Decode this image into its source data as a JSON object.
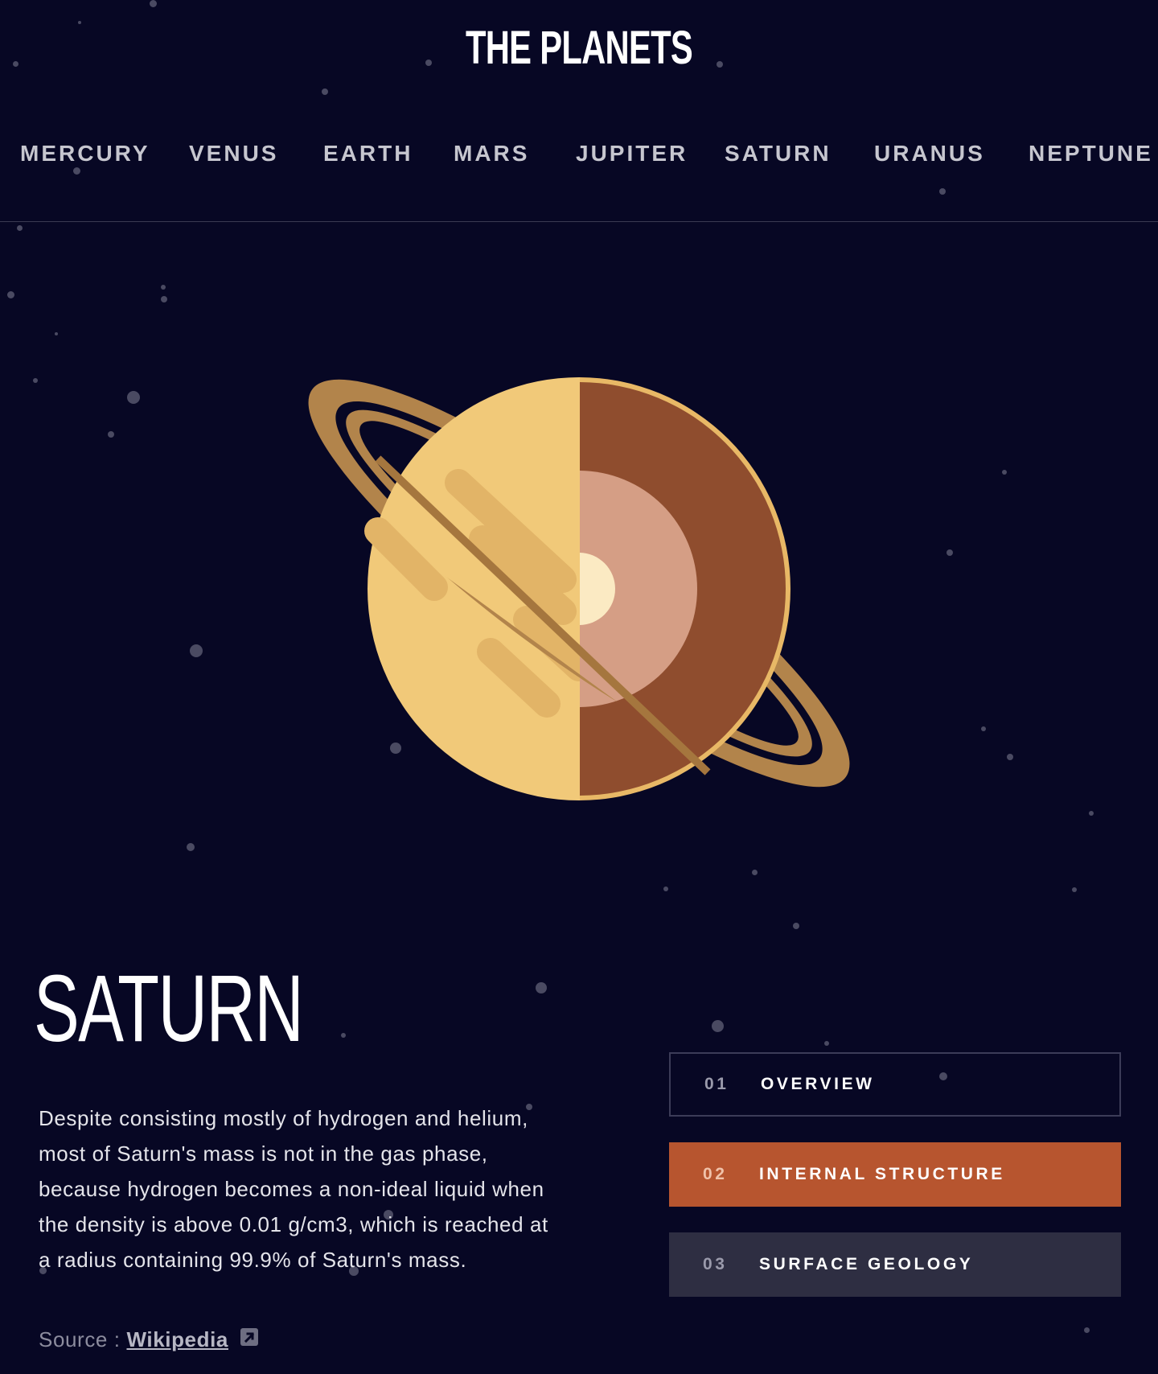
{
  "header": {
    "logo": "THE PLANETS"
  },
  "nav": {
    "items": [
      "MERCURY",
      "VENUS",
      "EARTH",
      "MARS",
      "JUPITER",
      "SATURN",
      "URANUS",
      "NEPTUNE"
    ]
  },
  "planet": {
    "name": "SATURN",
    "description": "Despite consisting mostly of hydrogen and helium, most of Saturn's mass is not in the gas phase, because hydrogen becomes a non-ideal liquid when the density is above 0.01 g/cm3, which is reached at a radius containing 99.9% of Saturn's mass.",
    "source_prefix": "Source : ",
    "source_link": "Wikipedia"
  },
  "tabs": [
    {
      "number": "01",
      "label": "OVERVIEW",
      "state": "inactive"
    },
    {
      "number": "02",
      "label": "INTERNAL STRUCTURE",
      "state": "active"
    },
    {
      "number": "03",
      "label": "SURFACE GEOLOGY",
      "state": "inactive"
    }
  ],
  "colors": {
    "background": "#070724",
    "accent": "#b7552f",
    "tab_inactive": "#2e2e42",
    "planet_surface": "#f1c979",
    "planet_core_outer": "#8f4d2e",
    "planet_core_mid": "#d59e85",
    "planet_core_inner": "#fbeac3",
    "ring": "#b2844b"
  },
  "icons": {
    "source": "external-link-icon"
  }
}
